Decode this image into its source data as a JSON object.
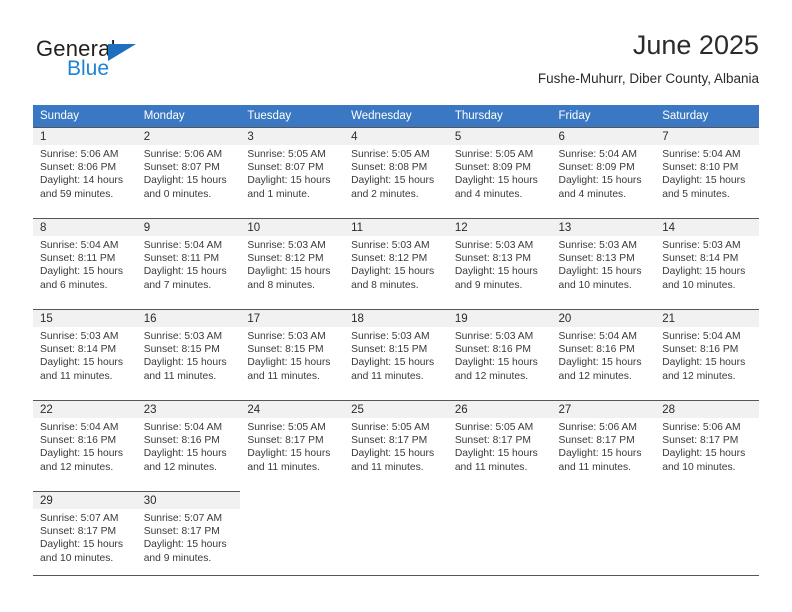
{
  "brand": {
    "name_top": "General",
    "name_bottom": "Blue",
    "triangle_color": "#1f6fc0",
    "blue_text_color": "#1f82d3"
  },
  "header": {
    "title": "June 2025",
    "subtitle": "Fushe-Muhurr, Diber County, Albania"
  },
  "theme": {
    "header_bg": "#3b78c3",
    "daynum_bg": "#f1f1f1",
    "rule_color": "#55565a",
    "text_color": "#2b2b2b"
  },
  "calendar": {
    "weekday_headers": [
      "Sunday",
      "Monday",
      "Tuesday",
      "Wednesday",
      "Thursday",
      "Friday",
      "Saturday"
    ],
    "weeks": [
      [
        {
          "day": "1",
          "sunrise": "Sunrise: 5:06 AM",
          "sunset": "Sunset: 8:06 PM",
          "daylight_1": "Daylight: 14 hours",
          "daylight_2": "and 59 minutes."
        },
        {
          "day": "2",
          "sunrise": "Sunrise: 5:06 AM",
          "sunset": "Sunset: 8:07 PM",
          "daylight_1": "Daylight: 15 hours",
          "daylight_2": "and 0 minutes."
        },
        {
          "day": "3",
          "sunrise": "Sunrise: 5:05 AM",
          "sunset": "Sunset: 8:07 PM",
          "daylight_1": "Daylight: 15 hours",
          "daylight_2": "and 1 minute."
        },
        {
          "day": "4",
          "sunrise": "Sunrise: 5:05 AM",
          "sunset": "Sunset: 8:08 PM",
          "daylight_1": "Daylight: 15 hours",
          "daylight_2": "and 2 minutes."
        },
        {
          "day": "5",
          "sunrise": "Sunrise: 5:05 AM",
          "sunset": "Sunset: 8:09 PM",
          "daylight_1": "Daylight: 15 hours",
          "daylight_2": "and 4 minutes."
        },
        {
          "day": "6",
          "sunrise": "Sunrise: 5:04 AM",
          "sunset": "Sunset: 8:09 PM",
          "daylight_1": "Daylight: 15 hours",
          "daylight_2": "and 4 minutes."
        },
        {
          "day": "7",
          "sunrise": "Sunrise: 5:04 AM",
          "sunset": "Sunset: 8:10 PM",
          "daylight_1": "Daylight: 15 hours",
          "daylight_2": "and 5 minutes."
        }
      ],
      [
        {
          "day": "8",
          "sunrise": "Sunrise: 5:04 AM",
          "sunset": "Sunset: 8:11 PM",
          "daylight_1": "Daylight: 15 hours",
          "daylight_2": "and 6 minutes."
        },
        {
          "day": "9",
          "sunrise": "Sunrise: 5:04 AM",
          "sunset": "Sunset: 8:11 PM",
          "daylight_1": "Daylight: 15 hours",
          "daylight_2": "and 7 minutes."
        },
        {
          "day": "10",
          "sunrise": "Sunrise: 5:03 AM",
          "sunset": "Sunset: 8:12 PM",
          "daylight_1": "Daylight: 15 hours",
          "daylight_2": "and 8 minutes."
        },
        {
          "day": "11",
          "sunrise": "Sunrise: 5:03 AM",
          "sunset": "Sunset: 8:12 PM",
          "daylight_1": "Daylight: 15 hours",
          "daylight_2": "and 8 minutes."
        },
        {
          "day": "12",
          "sunrise": "Sunrise: 5:03 AM",
          "sunset": "Sunset: 8:13 PM",
          "daylight_1": "Daylight: 15 hours",
          "daylight_2": "and 9 minutes."
        },
        {
          "day": "13",
          "sunrise": "Sunrise: 5:03 AM",
          "sunset": "Sunset: 8:13 PM",
          "daylight_1": "Daylight: 15 hours",
          "daylight_2": "and 10 minutes."
        },
        {
          "day": "14",
          "sunrise": "Sunrise: 5:03 AM",
          "sunset": "Sunset: 8:14 PM",
          "daylight_1": "Daylight: 15 hours",
          "daylight_2": "and 10 minutes."
        }
      ],
      [
        {
          "day": "15",
          "sunrise": "Sunrise: 5:03 AM",
          "sunset": "Sunset: 8:14 PM",
          "daylight_1": "Daylight: 15 hours",
          "daylight_2": "and 11 minutes."
        },
        {
          "day": "16",
          "sunrise": "Sunrise: 5:03 AM",
          "sunset": "Sunset: 8:15 PM",
          "daylight_1": "Daylight: 15 hours",
          "daylight_2": "and 11 minutes."
        },
        {
          "day": "17",
          "sunrise": "Sunrise: 5:03 AM",
          "sunset": "Sunset: 8:15 PM",
          "daylight_1": "Daylight: 15 hours",
          "daylight_2": "and 11 minutes."
        },
        {
          "day": "18",
          "sunrise": "Sunrise: 5:03 AM",
          "sunset": "Sunset: 8:15 PM",
          "daylight_1": "Daylight: 15 hours",
          "daylight_2": "and 11 minutes."
        },
        {
          "day": "19",
          "sunrise": "Sunrise: 5:03 AM",
          "sunset": "Sunset: 8:16 PM",
          "daylight_1": "Daylight: 15 hours",
          "daylight_2": "and 12 minutes."
        },
        {
          "day": "20",
          "sunrise": "Sunrise: 5:04 AM",
          "sunset": "Sunset: 8:16 PM",
          "daylight_1": "Daylight: 15 hours",
          "daylight_2": "and 12 minutes."
        },
        {
          "day": "21",
          "sunrise": "Sunrise: 5:04 AM",
          "sunset": "Sunset: 8:16 PM",
          "daylight_1": "Daylight: 15 hours",
          "daylight_2": "and 12 minutes."
        }
      ],
      [
        {
          "day": "22",
          "sunrise": "Sunrise: 5:04 AM",
          "sunset": "Sunset: 8:16 PM",
          "daylight_1": "Daylight: 15 hours",
          "daylight_2": "and 12 minutes."
        },
        {
          "day": "23",
          "sunrise": "Sunrise: 5:04 AM",
          "sunset": "Sunset: 8:16 PM",
          "daylight_1": "Daylight: 15 hours",
          "daylight_2": "and 12 minutes."
        },
        {
          "day": "24",
          "sunrise": "Sunrise: 5:05 AM",
          "sunset": "Sunset: 8:17 PM",
          "daylight_1": "Daylight: 15 hours",
          "daylight_2": "and 11 minutes."
        },
        {
          "day": "25",
          "sunrise": "Sunrise: 5:05 AM",
          "sunset": "Sunset: 8:17 PM",
          "daylight_1": "Daylight: 15 hours",
          "daylight_2": "and 11 minutes."
        },
        {
          "day": "26",
          "sunrise": "Sunrise: 5:05 AM",
          "sunset": "Sunset: 8:17 PM",
          "daylight_1": "Daylight: 15 hours",
          "daylight_2": "and 11 minutes."
        },
        {
          "day": "27",
          "sunrise": "Sunrise: 5:06 AM",
          "sunset": "Sunset: 8:17 PM",
          "daylight_1": "Daylight: 15 hours",
          "daylight_2": "and 11 minutes."
        },
        {
          "day": "28",
          "sunrise": "Sunrise: 5:06 AM",
          "sunset": "Sunset: 8:17 PM",
          "daylight_1": "Daylight: 15 hours",
          "daylight_2": "and 10 minutes."
        }
      ],
      [
        {
          "day": "29",
          "sunrise": "Sunrise: 5:07 AM",
          "sunset": "Sunset: 8:17 PM",
          "daylight_1": "Daylight: 15 hours",
          "daylight_2": "and 10 minutes."
        },
        {
          "day": "30",
          "sunrise": "Sunrise: 5:07 AM",
          "sunset": "Sunset: 8:17 PM",
          "daylight_1": "Daylight: 15 hours",
          "daylight_2": "and 9 minutes."
        },
        {
          "day": "",
          "sunrise": "",
          "sunset": "",
          "daylight_1": "",
          "daylight_2": ""
        },
        {
          "day": "",
          "sunrise": "",
          "sunset": "",
          "daylight_1": "",
          "daylight_2": ""
        },
        {
          "day": "",
          "sunrise": "",
          "sunset": "",
          "daylight_1": "",
          "daylight_2": ""
        },
        {
          "day": "",
          "sunrise": "",
          "sunset": "",
          "daylight_1": "",
          "daylight_2": ""
        },
        {
          "day": "",
          "sunrise": "",
          "sunset": "",
          "daylight_1": "",
          "daylight_2": ""
        }
      ]
    ]
  }
}
